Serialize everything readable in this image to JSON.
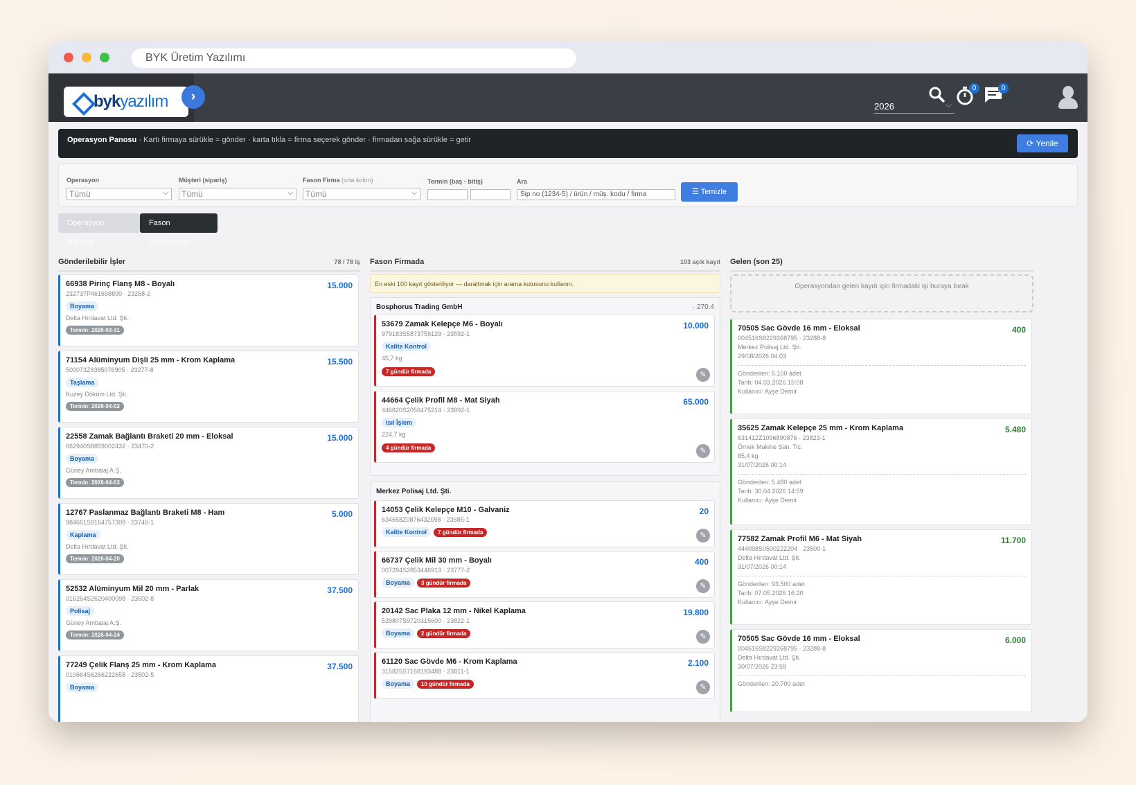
{
  "browser": {
    "title": "BYK Üretim Yazılımı"
  },
  "logo": {
    "brand_bold": "byk",
    "brand_light": "yazılım"
  },
  "topbar": {
    "year": "2026",
    "timer_badge": "0",
    "messages_badge": "0"
  },
  "opbar": {
    "title": "Operasyon Panosu",
    "help": " · Kartı firmaya sürükle = gönder · karta tıkla = firma seçerek gönder · firmadan sağa sürükle = getir",
    "refresh": "Yenile"
  },
  "filters": {
    "operasyon": {
      "label": "Operasyon",
      "value": "Tümü"
    },
    "musteri": {
      "label": "Müşteri (sipariş)",
      "value": "Tümü"
    },
    "fason": {
      "label": "Fason Firma",
      "hint": "(orta kolon)",
      "value": "Tümü"
    },
    "termin": {
      "label": "Termin (baş - bitiş)"
    },
    "ara": {
      "label": "Ara",
      "placeholder": "Sip no (1234-5) / ürün / müş. kodu / firma"
    },
    "clear": "Temizle"
  },
  "tabs": {
    "a": "Operasyon Panosu",
    "b": "Fason Performans"
  },
  "col1": {
    "title": "Gönderilebilir İşler",
    "count": "78 / 78 iş",
    "cards": [
      {
        "title": "66938 Pirinç Flanş M8 - Boyalı",
        "qty": "15.000",
        "code": "232737P461698890 · 23268-2",
        "op": "Boyama",
        "firm": "Delta Hırdavat Ltd. Şti.",
        "termin": "Termin: 2026-03-31"
      },
      {
        "title": "71154 Alüminyum Dişli 25 mm - Krom Kaplama",
        "qty": "15.500",
        "code": "500073Z6385076905 · 23277-8",
        "op": "Taşlama",
        "firm": "Kuzey Döküm Ltd. Şti.",
        "termin": "Termin: 2026-04-02"
      },
      {
        "title": "22558 Zamak Bağlantı Braketi 20 mm - Eloksal",
        "qty": "15.000",
        "code": "662940S8859002432 · 23470-2",
        "op": "Boyama",
        "firm": "Güney Ambalaj A.Ş.",
        "termin": "Termin: 2026-04-03"
      },
      {
        "title": "12767 Paslanmaz Bağlantı Braketi M8 - Ham",
        "qty": "5.000",
        "code": "984661S9164757309 · 23745-1",
        "op": "Kaplama",
        "firm": "Delta Hırdavat Ltd. Şti.",
        "termin": "Termin: 2026-04-20"
      },
      {
        "title": "52532 Alüminyum Mil 20 mm - Parlak",
        "qty": "37.500",
        "code": "016264S2620400098 · 23502-8",
        "op": "Polisaj",
        "firm": "Güney Ambalaj A.Ş.",
        "termin": "Termin: 2026-04-24"
      },
      {
        "title": "77249 Çelik Flanş 25 mm - Krom Kaplama",
        "qty": "37.500",
        "code": "010664S6266222658 · 23502-5",
        "op": "Boyama",
        "firm": "",
        "termin": ""
      }
    ]
  },
  "col2": {
    "title": "Fason Firmada",
    "count": "103 açık kayıt",
    "notice": "En eski 100 kayıt gösteriliyor — daraltmak için arama kutusunu kullanın.",
    "group1": {
      "name": "Bosphorus Trading GmbH",
      "sum": "· 270.4",
      "cards": [
        {
          "title": "53679 Zamak Kelepçe M6 - Boyalı",
          "qty": "10.000",
          "code": "979183S5873759129 · 23592-1",
          "op": "Kalite Kontrol",
          "kg": "45,7 kg",
          "gun": "7 gündür firmada"
        },
        {
          "title": "44664 Çelik Profil M8 - Mat Siyah",
          "qty": "65.000",
          "code": "446820S2056475214 · 23892-1",
          "op": "Isıl İşlem",
          "kg": "224,7 kg",
          "gun": "4 gündür firmada"
        }
      ]
    },
    "group2": {
      "name": "Merkez Polisaj Ltd. Şti.",
      "cards": [
        {
          "title": "14053 Çelik Kelepçe M10 - Galvaniz",
          "qty": "20",
          "code": "634658Z0876432098 · 23685-1",
          "op": "Kalite Kontrol",
          "gun": "7 gündür firmada"
        },
        {
          "title": "66737 Çelik Mil 30 mm - Boyalı",
          "qty": "400",
          "code": "007284S2853446913 · 23777-2",
          "op": "Boyama",
          "gun": "3 gündür firmada"
        },
        {
          "title": "20142 Sac Plaka 12 mm - Nikel Kaplama",
          "qty": "19.800",
          "code": "539807S9720315600 · 23822-1",
          "op": "Boyama",
          "gun": "2 gündür firmada"
        },
        {
          "title": "61120 Sac Gövde M6 - Krom Kaplama",
          "qty": "2.100",
          "code": "315825S7168193488 · 23811-1",
          "op": "Boyama",
          "gun": "10 gündür firmada"
        }
      ]
    }
  },
  "col3": {
    "title": "Gelen (son 25)",
    "drop": "Operasyondan gelen kaydı için firmadaki işi buraya bırak",
    "cards": [
      {
        "title": "70505 Sac Gövde 16 mm - Eloksal",
        "qty": "400",
        "code": "004516S8229268795 · 23288-8",
        "firm": "Merkez Polisaj Ltd. Şti.",
        "kg": "",
        "date": "29/08/2026 04:03",
        "sent": "Gönderilen: 5.100 adet",
        "tarih": "Tarih: 04.03.2026 15:08",
        "user": "Kullanıcı: Ayşe Demir"
      },
      {
        "title": "35625 Zamak Kelepçe 25 mm - Krom Kaplama",
        "qty": "5.480",
        "code": "631412Z1096890876 · 23823-1",
        "firm": "Örnek Makine San. Tic.",
        "kg": "85,4 kg",
        "date": "31/07/2026 00:14",
        "sent": "Gönderilen: 5.480 adet",
        "tarih": "Tarih: 30.04.2026 14:59",
        "user": "Kullanıcı: Ayşe Demir"
      },
      {
        "title": "77582 Zamak Profil M6 - Mat Siyah",
        "qty": "11.700",
        "code": "444098S0500222204 · 23500-1",
        "firm": "Delta Hırdavat Ltd. Şti.",
        "kg": "",
        "date": "31/07/2026 00:14",
        "sent": "Gönderilen: 93.500 adet",
        "tarih": "Tarih: 07.05.2026 16:20",
        "user": "Kullanıcı: Ayşe Demir"
      },
      {
        "title": "70505 Sac Gövde 16 mm - Eloksal",
        "qty": "6.000",
        "code": "004516S8229268795 · 23288-8",
        "firm": "Delta Hırdavat Ltd. Şti.",
        "kg": "",
        "date": "30/07/2026 23:59",
        "sent": "Gönderilen: 20.700 adet",
        "tarih": "",
        "user": ""
      }
    ]
  }
}
